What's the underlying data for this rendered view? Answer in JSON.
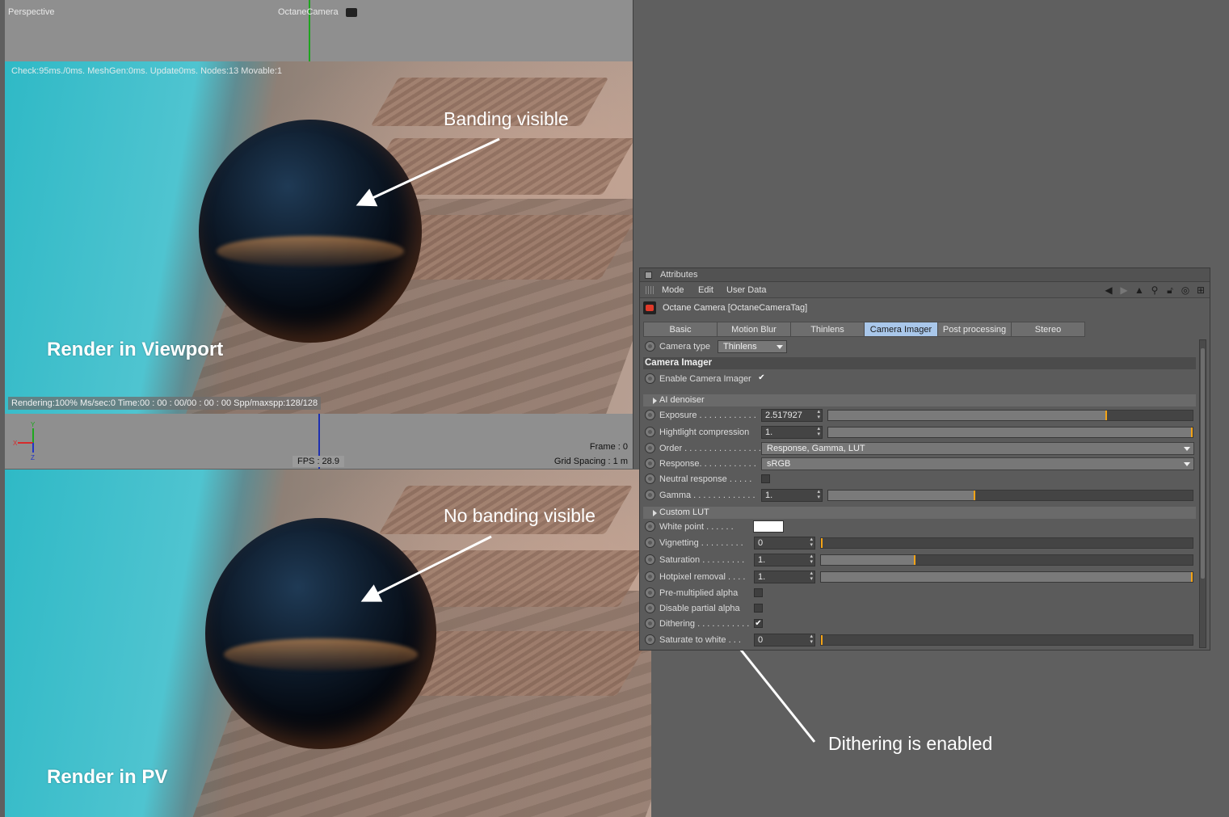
{
  "viewport": {
    "view_name": "Perspective",
    "camera_name": "OctaneCamera",
    "stats": "Check:95ms./0ms. MeshGen:0ms. Update0ms. Nodes:13 Movable:1",
    "render_status": "Rendering:100% Ms/sec:0 Time:00 : 00 : 00/00 : 00 : 00 Spp/maxspp:128/128",
    "fps": "FPS : 28.9",
    "frame": "Frame : 0",
    "grid_spacing": "Grid Spacing : 1 m",
    "axis_labels": {
      "x": "X",
      "y": "Y",
      "z": "Z"
    }
  },
  "captions": {
    "viewport": "Render in Viewport",
    "pv": "Render in PV"
  },
  "annotations": {
    "banding": "Banding visible",
    "no_banding": "No banding visible",
    "dithering": "Dithering is enabled"
  },
  "attributes": {
    "title": "Attributes",
    "menu": [
      "Mode",
      "Edit",
      "User Data"
    ],
    "object_name": "Octane Camera [OctaneCameraTag]",
    "tabs": [
      "Basic",
      "Motion Blur",
      "Thinlens",
      "Camera Imager",
      "Post processing",
      "Stereo"
    ],
    "active_tab": "Camera Imager",
    "camera_type_label": "Camera type",
    "camera_type_value": "Thinlens",
    "section_title": "Camera Imager",
    "enable_label": "Enable Camera Imager",
    "ai_denoiser": "AI denoiser",
    "exposure_label": "Exposure . . . . . . . . . . . .",
    "exposure_value": "2.517927",
    "highlight_label": "Hightlight compression",
    "highlight_value": "1.",
    "order_label": "Order . . . . . . . . . . . . . . . . .",
    "order_value": "Response, Gamma, LUT",
    "response_label": "Response. . . . . . . . . . . .",
    "response_value": "sRGB",
    "neutral_label": "Neutral response . . . . .",
    "gamma_label": "Gamma . . . . . . . . . . . . .",
    "gamma_value": "1.",
    "custom_lut": "Custom LUT",
    "white_point_label": "White point . . . . . .",
    "vignetting_label": "Vignetting . . . . . . . . .",
    "vignetting_value": "0",
    "saturation_label": "Saturation . . . . . . . . .",
    "saturation_value": "1.",
    "hotpixel_label": "Hotpixel removal . . . .",
    "hotpixel_value": "1.",
    "premult_label": "Pre-multiplied alpha",
    "partial_alpha_label": "Disable partial alpha",
    "dithering_label": "Dithering . . . . . . . . . . .",
    "saturate_label": "Saturate to white . . .",
    "saturate_value": "0",
    "checked_glyph": "✔",
    "slider_levels": {
      "exposure": 0.76,
      "highlight": 1.0,
      "gamma": 0.4,
      "vignetting": 0.0,
      "saturation": 0.25,
      "hotpixel": 1.0,
      "saturate": 0.0
    },
    "accent_color": "#f3a316",
    "active_tab_color": "#a9c7ea"
  }
}
